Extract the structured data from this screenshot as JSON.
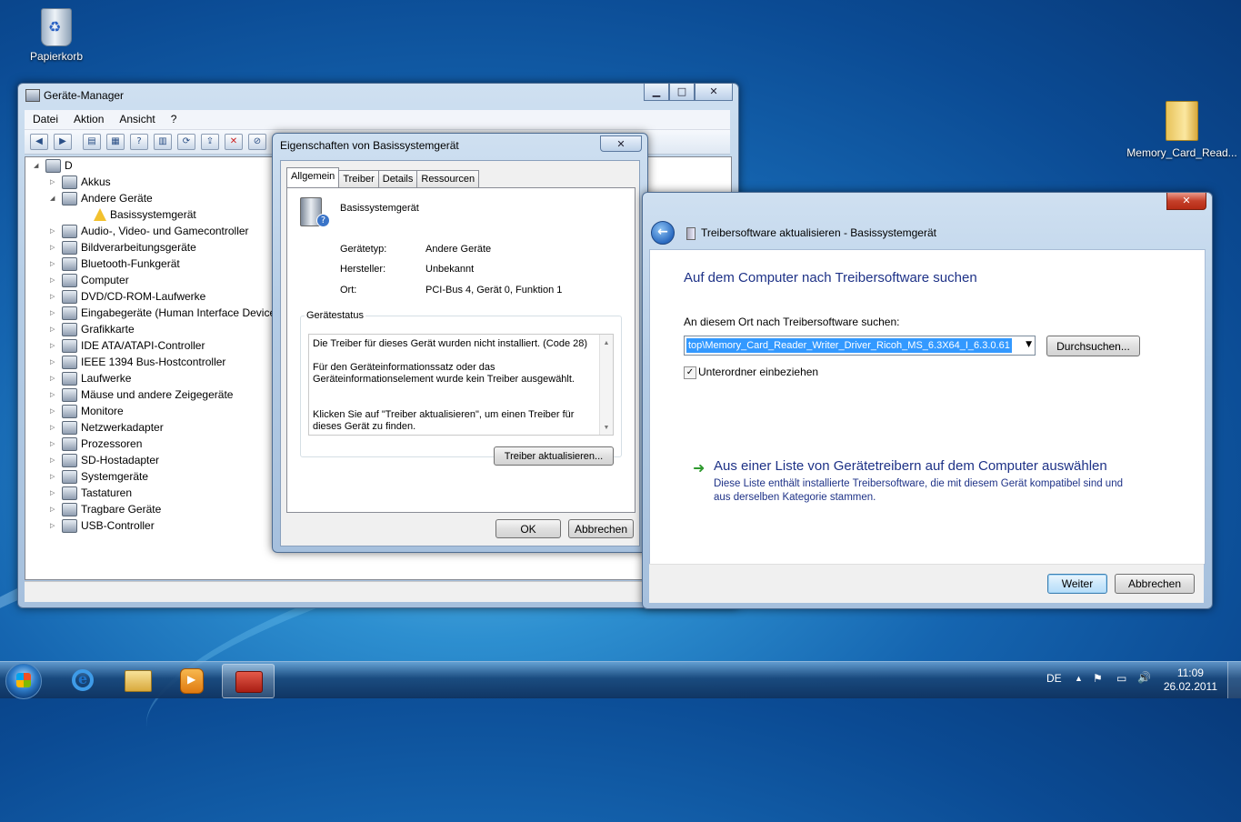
{
  "desktop": {
    "recycle_bin_label": "Papierkorb",
    "folder_label": "Memory_Card_Read..."
  },
  "device_manager": {
    "title": "Geräte-Manager",
    "menu": [
      "Datei",
      "Aktion",
      "Ansicht",
      "?"
    ],
    "root": "D",
    "items": [
      {
        "label": "Akkus",
        "expander": "▷",
        "indent": 0
      },
      {
        "label": "Andere Geräte",
        "expander": "◢",
        "indent": 0
      },
      {
        "label": "Basissystemgerät",
        "expander": "",
        "indent": 1,
        "warning": true
      },
      {
        "label": "Audio-, Video- und Gamecontroller",
        "expander": "▷",
        "indent": 0
      },
      {
        "label": "Bildverarbeitungsgeräte",
        "expander": "▷",
        "indent": 0
      },
      {
        "label": "Bluetooth-Funkgerät",
        "expander": "▷",
        "indent": 0
      },
      {
        "label": "Computer",
        "expander": "▷",
        "indent": 0
      },
      {
        "label": "DVD/CD-ROM-Laufwerke",
        "expander": "▷",
        "indent": 0
      },
      {
        "label": "Eingabegeräte (Human Interface Devices)",
        "expander": "▷",
        "indent": 0
      },
      {
        "label": "Grafikkarte",
        "expander": "▷",
        "indent": 0
      },
      {
        "label": "IDE ATA/ATAPI-Controller",
        "expander": "▷",
        "indent": 0
      },
      {
        "label": "IEEE 1394 Bus-Hostcontroller",
        "expander": "▷",
        "indent": 0
      },
      {
        "label": "Laufwerke",
        "expander": "▷",
        "indent": 0
      },
      {
        "label": "Mäuse und andere Zeigegeräte",
        "expander": "▷",
        "indent": 0
      },
      {
        "label": "Monitore",
        "expander": "▷",
        "indent": 0
      },
      {
        "label": "Netzwerkadapter",
        "expander": "▷",
        "indent": 0
      },
      {
        "label": "Prozessoren",
        "expander": "▷",
        "indent": 0
      },
      {
        "label": "SD-Hostadapter",
        "expander": "▷",
        "indent": 0
      },
      {
        "label": "Systemgeräte",
        "expander": "▷",
        "indent": 0
      },
      {
        "label": "Tastaturen",
        "expander": "▷",
        "indent": 0
      },
      {
        "label": "Tragbare Geräte",
        "expander": "▷",
        "indent": 0
      },
      {
        "label": "USB-Controller",
        "expander": "▷",
        "indent": 0
      }
    ]
  },
  "properties": {
    "title": "Eigenschaften von Basissystemgerät",
    "tabs": [
      "Allgemein",
      "Treiber",
      "Details",
      "Ressourcen"
    ],
    "device_name": "Basissystemgerät",
    "fields": [
      {
        "label": "Gerätetyp:",
        "value": "Andere Geräte"
      },
      {
        "label": "Hersteller:",
        "value": "Unbekannt"
      },
      {
        "label": "Ort:",
        "value": "PCI-Bus 4, Gerät 0, Funktion 1"
      }
    ],
    "status_group": "Gerätestatus",
    "status_lines": [
      "Die Treiber für dieses Gerät wurden nicht installiert. (Code 28)",
      "Für den Geräteinformationssatz oder das Geräteinformationselement wurde kein Treiber ausgewählt.",
      "Klicken Sie auf \"Treiber aktualisieren\", um einen Treiber für dieses Gerät zu finden."
    ],
    "update_button": "Treiber aktualisieren...",
    "ok_button": "OK",
    "cancel_button": "Abbrechen"
  },
  "wizard": {
    "title": "Treibersoftware aktualisieren - Basissystemgerät",
    "headline": "Auf dem Computer nach Treibersoftware suchen",
    "search_label": "An diesem Ort nach Treibersoftware suchen:",
    "path_value": "top\\Memory_Card_Reader_Writer_Driver_Ricoh_MS_6.3X64_I_6.3.0.61",
    "browse_button": "Durchsuchen...",
    "subfolders_label": "Unterordner einbeziehen",
    "subfolders_checked": true,
    "list_link_title": "Aus einer Liste von Gerätetreibern auf dem Computer auswählen",
    "list_link_desc": "Diese Liste enthält installierte Treibersoftware, die mit diesem Gerät kompatibel sind und aus derselben Kategorie stammen.",
    "next_button": "Weiter",
    "cancel_button": "Abbrechen"
  },
  "taskbar": {
    "language": "DE",
    "time": "11:09",
    "date": "26.02.2011"
  }
}
